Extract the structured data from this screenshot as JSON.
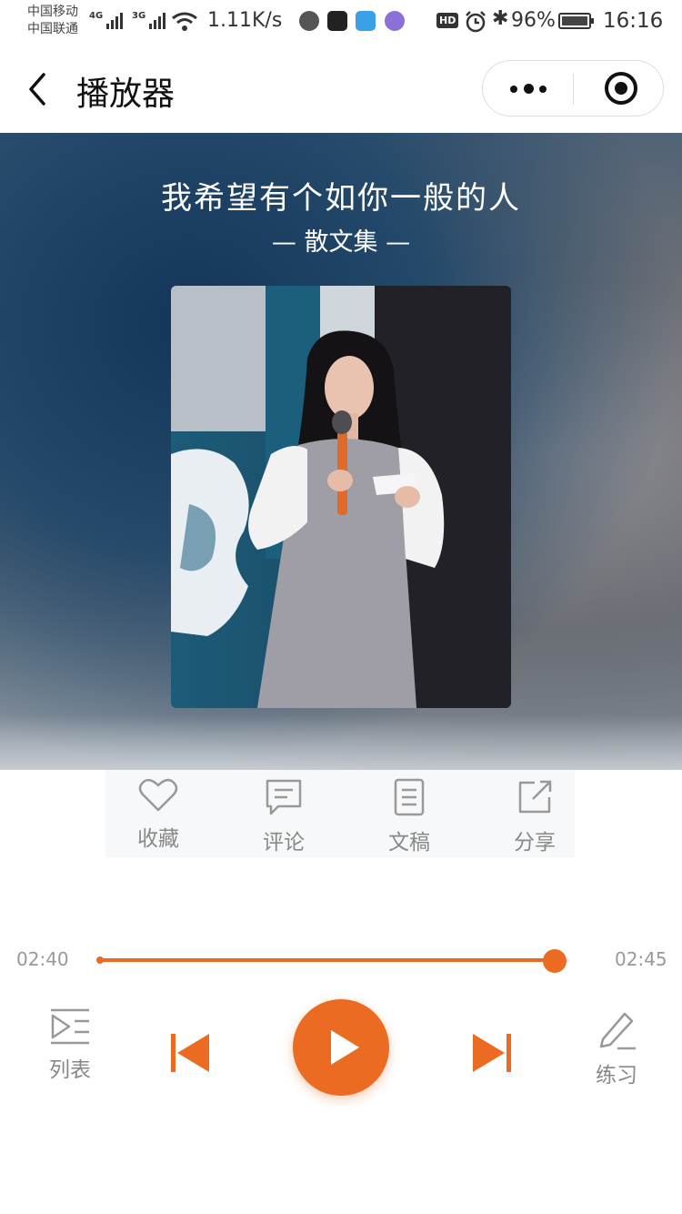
{
  "status_bar": {
    "carrier_1": "中国移动",
    "carrier_2": "中国联通",
    "network_1": "4G",
    "network_2": "3G",
    "speed": "1.11K/s",
    "hd": "HD",
    "battery": "96%",
    "time": "16:16"
  },
  "nav": {
    "title": "播放器"
  },
  "track": {
    "title": "我希望有个如你一般的人",
    "album": "— 散文集 —"
  },
  "actions": [
    {
      "label": "收藏",
      "icon": "heart-icon"
    },
    {
      "label": "评论",
      "icon": "comment-icon"
    },
    {
      "label": "文稿",
      "icon": "document-icon"
    },
    {
      "label": "分享",
      "icon": "share-icon"
    }
  ],
  "progress": {
    "current": "02:40",
    "total": "02:45",
    "fraction": 0.97
  },
  "controls": {
    "playlist_label": "列表",
    "practice_label": "练习",
    "accent": "#ec6b22"
  }
}
